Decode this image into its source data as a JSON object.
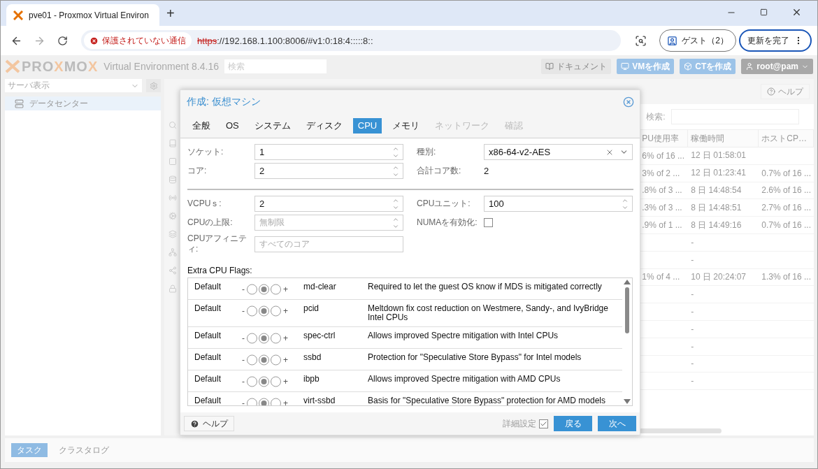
{
  "browser": {
    "tab_title": "pve01 - Proxmox Virtual Environ",
    "new_tab": "+",
    "security_chip": "保護されていない通信",
    "url_scheme": "https",
    "url_rest": "://192.168.1.100:8006/#v1:0:18:4:::::8::",
    "profile": "ゲスト（2）",
    "update": "更新を完了"
  },
  "header": {
    "logo": [
      {
        "text": "PRO",
        "accent": false
      },
      {
        "text": "X",
        "accent": true
      },
      {
        "text": "MO",
        "accent": false
      },
      {
        "text": "X",
        "accent": true
      }
    ],
    "product": "Virtual Environment 8.4.16",
    "search_placeholder": "検索",
    "buttons": [
      {
        "label": "ドキュメント",
        "kind": "plain"
      },
      {
        "label": "VMを作成",
        "kind": "primary"
      },
      {
        "label": "CTを作成",
        "kind": "primary"
      }
    ],
    "user": "root@pam"
  },
  "sidebar": {
    "view_select": "サーバ表示",
    "tree": [
      {
        "label": "データセンター",
        "selected": true
      }
    ]
  },
  "content": {
    "help": "ヘルプ",
    "search_label": "検索:",
    "columns": [
      "PU使用率",
      "稼働時間",
      "ホストCP…"
    ],
    "rows": [
      [
        "6% of 16 ...",
        "12 日 01:58:01",
        ""
      ],
      [
        "3% of 2 ...",
        "12 日 01:23:41",
        "0.7% of 16 ..."
      ],
      [
        ".8% of 3 ...",
        "8 日 14:48:54",
        "2.6% of 16 ..."
      ],
      [
        ".3% of 3 ...",
        "8 日 14:48:51",
        "2.7% of 16 ..."
      ],
      [
        ".9% of 1 ...",
        "8 日 14:49:16",
        "0.7% of 16 ..."
      ],
      [
        "",
        "-",
        ""
      ],
      [
        "",
        "-",
        ""
      ],
      [
        "1% of 4 ...",
        "10 日 20:24:07",
        "1.3% of 16 ..."
      ],
      [
        "",
        "-",
        ""
      ],
      [
        "",
        "-",
        ""
      ],
      [
        "",
        "-",
        ""
      ],
      [
        "",
        "-",
        ""
      ],
      [
        "",
        "-",
        ""
      ],
      [
        "",
        "-",
        ""
      ]
    ]
  },
  "bottom_tabs": [
    {
      "label": "タスク",
      "selected": true
    },
    {
      "label": "クラスタログ",
      "selected": false
    }
  ],
  "dialog": {
    "title": "作成: 仮想マシン",
    "tabs": [
      {
        "label": "全般",
        "selected": false,
        "disabled": false
      },
      {
        "label": "OS",
        "selected": false,
        "disabled": false
      },
      {
        "label": "システム",
        "selected": false,
        "disabled": false
      },
      {
        "label": "ディスク",
        "selected": false,
        "disabled": false
      },
      {
        "label": "CPU",
        "selected": true,
        "disabled": false
      },
      {
        "label": "メモリ",
        "selected": false,
        "disabled": false
      },
      {
        "label": "ネットワーク",
        "selected": false,
        "disabled": true
      },
      {
        "label": "確認",
        "selected": false,
        "disabled": true
      }
    ],
    "basic_left": [
      {
        "label": "ソケット:",
        "kind": "spinner",
        "value": "1"
      },
      {
        "label": "コア:",
        "kind": "spinner",
        "value": "2"
      }
    ],
    "basic_right": [
      {
        "label": "種別:",
        "kind": "combo",
        "value": "x86-64-v2-AES"
      },
      {
        "label": "合計コア数:",
        "kind": "display",
        "value": "2"
      }
    ],
    "advanced_left": [
      {
        "label": "VCPUｓ:",
        "kind": "spinner",
        "value": "2"
      },
      {
        "label": "CPUの上限:",
        "kind": "spinner",
        "placeholder": "無制限"
      },
      {
        "label": "CPUアフィニティ:",
        "kind": "text",
        "placeholder": "すべてのコア"
      }
    ],
    "advanced_right": [
      {
        "label": "CPUユニット:",
        "kind": "spinner",
        "value": "100"
      },
      {
        "label": "NUMAを有効化:",
        "kind": "checkbox",
        "checked": false
      }
    ],
    "flags_label": "Extra CPU Flags:",
    "flags": [
      {
        "value": "Default",
        "minus": "-",
        "plus": "+",
        "options": [
          {
            "selected": false
          },
          {
            "selected": true
          },
          {
            "selected": false
          }
        ],
        "name": "md-clear",
        "description": "Required to let the guest OS know if MDS is mitigated correctly"
      },
      {
        "value": "Default",
        "minus": "-",
        "plus": "+",
        "options": [
          {
            "selected": false
          },
          {
            "selected": true
          },
          {
            "selected": false
          }
        ],
        "name": "pcid",
        "description": "Meltdown fix cost reduction on Westmere, Sandy-, and IvyBridge Intel CPUs"
      },
      {
        "value": "Default",
        "minus": "-",
        "plus": "+",
        "options": [
          {
            "selected": false
          },
          {
            "selected": true
          },
          {
            "selected": false
          }
        ],
        "name": "spec-ctrl",
        "description": "Allows improved Spectre mitigation with Intel CPUs"
      },
      {
        "value": "Default",
        "minus": "-",
        "plus": "+",
        "options": [
          {
            "selected": false
          },
          {
            "selected": true
          },
          {
            "selected": false
          }
        ],
        "name": "ssbd",
        "description": "Protection for \"Speculative Store Bypass\" for Intel models"
      },
      {
        "value": "Default",
        "minus": "-",
        "plus": "+",
        "options": [
          {
            "selected": false
          },
          {
            "selected": true
          },
          {
            "selected": false
          }
        ],
        "name": "ibpb",
        "description": "Allows improved Spectre mitigation with AMD CPUs"
      },
      {
        "value": "Default",
        "minus": "-",
        "plus": "+",
        "options": [
          {
            "selected": false
          },
          {
            "selected": true
          },
          {
            "selected": false
          }
        ],
        "name": "virt-ssbd",
        "description": "Basis for \"Speculative Store Bypass\" protection for AMD models"
      }
    ],
    "help": "ヘルプ",
    "advanced": {
      "label": "詳細設定",
      "checked": true
    },
    "back": "戻る",
    "next": "次へ"
  }
}
